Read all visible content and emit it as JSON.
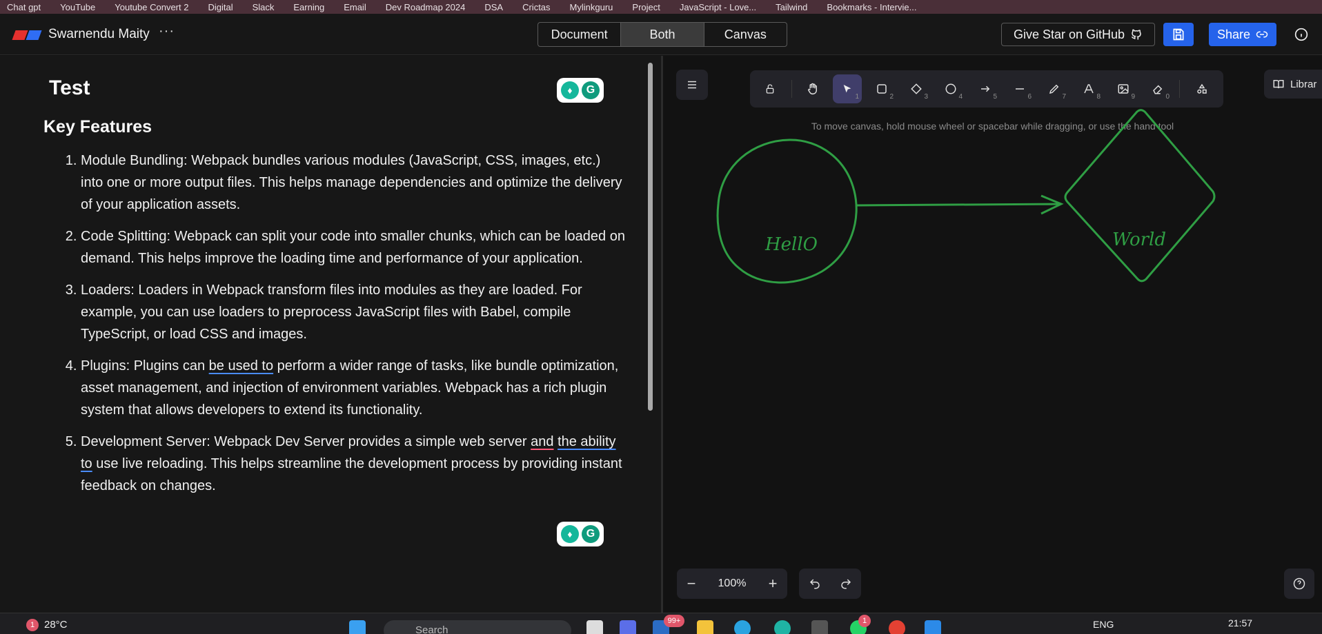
{
  "bookmarks": [
    "Chat gpt",
    "YouTube",
    "Youtube Convert 2",
    "Digital",
    "Slack",
    "Earning",
    "Email",
    "Dev Roadmap 2024",
    "DSA",
    "Crictas",
    "Mylinkguru",
    "Project",
    "JavaScript - Love...",
    "Tailwind",
    "Bookmarks - Intervie..."
  ],
  "header": {
    "user_name": "Swarnendu Maity",
    "more_label": "···",
    "tabs": [
      {
        "label": "Document",
        "active": false
      },
      {
        "label": "Both",
        "active": true
      },
      {
        "label": "Canvas",
        "active": false
      }
    ],
    "github_label": "Give Star on GitHub",
    "share_label": "Share",
    "accent": "#2563eb"
  },
  "document": {
    "title": "Test",
    "heading": "Key Features",
    "items": [
      {
        "before": "Module Bundling: Webpack bundles various modules (JavaScript, CSS, images, etc.) into one or more output files. This helps manage dependencies and optimize the delivery of your application assets."
      },
      {
        "before": "Code Splitting: Webpack can split your code into smaller chunks, which can be loaded on demand. This helps improve the loading time and performance of your application."
      },
      {
        "before": "Loaders: Loaders in Webpack transform files into modules as they are loaded. For example, you can use loaders to preprocess JavaScript files with Babel, compile TypeScript, or load CSS and images."
      },
      {
        "before": "Plugins: Plugins can ",
        "underline1": "be used to",
        "after": " perform a wider range of tasks, like bundle optimization, asset management, and injection of environment variables. Webpack has a rich plugin system that allows developers to extend its functionality."
      },
      {
        "before": "Development Server: Webpack Dev Server provides a simple web server ",
        "underline_red": "and",
        "space": " ",
        "underline1": "the ability to",
        "after": " use live reloading. This helps streamline the development process by providing instant feedback on changes."
      }
    ]
  },
  "canvas": {
    "hint": "To move canvas, hold mouse wheel or spacebar while dragging, or use the hand tool",
    "library_label": "Librar",
    "tools": [
      {
        "icon": "lock-icon",
        "key": ""
      },
      {
        "icon": "hand-icon",
        "key": ""
      },
      {
        "icon": "pointer-icon",
        "key": "1",
        "active": true
      },
      {
        "icon": "rectangle-icon",
        "key": "2"
      },
      {
        "icon": "diamond-icon",
        "key": "3"
      },
      {
        "icon": "ellipse-icon",
        "key": "4"
      },
      {
        "icon": "arrow-icon",
        "key": "5"
      },
      {
        "icon": "line-icon",
        "key": "6"
      },
      {
        "icon": "pencil-icon",
        "key": "7"
      },
      {
        "icon": "text-icon",
        "key": "8"
      },
      {
        "icon": "image-icon",
        "key": "9"
      },
      {
        "icon": "eraser-icon",
        "key": "0"
      },
      {
        "icon": "shapes-icon",
        "key": ""
      }
    ],
    "shape_color": "#2f9e44",
    "circle_label": "HellO",
    "diamond_label": "World",
    "zoom": "100%",
    "zoom_out": "−",
    "zoom_in": "+"
  },
  "taskbar": {
    "weather": "28°C",
    "weather_badge": "1",
    "search_placeholder": "Search",
    "store_badge": "99+",
    "whatsapp_badge": "1",
    "language": "ENG",
    "time": "21:57"
  }
}
